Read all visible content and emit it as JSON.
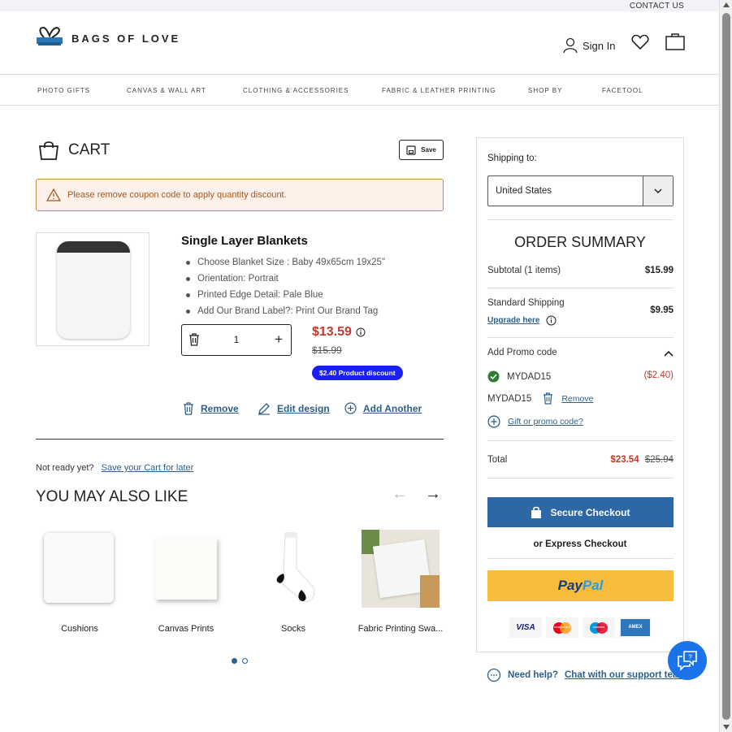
{
  "topbar": {
    "contact": "CONTACT US"
  },
  "header": {
    "logo_text": "BAGS OF LOVE",
    "signin": "Sign In"
  },
  "nav": [
    "PHOTO GIFTS",
    "CANVAS & WALL ART",
    "CLOTHING & ACCESSORIES",
    "FABRIC & LEATHER PRINTING",
    "SHOP BY",
    "FACETOOL"
  ],
  "cart": {
    "title": "CART",
    "save_label": "Save",
    "alert": "Please remove coupon code to apply quantity discount.",
    "item": {
      "name": "Single Layer Blankets",
      "options": [
        "Choose Blanket Size : Baby 49x65cm 19x25\"",
        "Orientation: Portrait",
        "Printed Edge Detail: Pale Blue",
        "Add Our Brand Label?: Print Our Brand Tag"
      ],
      "quantity": "1",
      "price": "$13.59",
      "old_price": "$15.99",
      "discount": "$2.40 Product discount"
    },
    "actions": {
      "remove": "Remove",
      "edit": "Edit design",
      "add": "Add Another"
    },
    "not_ready": "Not ready yet?",
    "save_later": "Save your Cart for later"
  },
  "recommendations": {
    "title": "YOU MAY ALSO LIKE",
    "items": [
      "Cushions",
      "Canvas Prints",
      "Socks",
      "Fabric Printing Swa..."
    ]
  },
  "summary": {
    "shipping_label": "Shipping to:",
    "country": "United States",
    "title": "ORDER SUMMARY",
    "subtotal_label": "Subtotal (1 items)",
    "subtotal": "$15.99",
    "shipping_name": "Standard Shipping",
    "upgrade": "Upgrade here",
    "shipping": "$9.95",
    "promo_label": "Add Promo code",
    "promo_code": "MYDAD15",
    "promo_amount": "($2.40)",
    "promo_code2": "MYDAD15",
    "promo_remove": "Remove",
    "gift_link": "Gift or promo code?",
    "total_label": "Total",
    "total": "$23.54",
    "total_old": "$25.94",
    "checkout": "Secure Checkout",
    "express": "or Express Checkout",
    "paypal_pay": "Pay",
    "paypal_pal": "Pal",
    "cards": [
      "VISA",
      "mastercard",
      "maestro",
      "AMEX"
    ]
  },
  "help": {
    "text": "Need help?",
    "link": "Chat with our support team"
  },
  "colors": {
    "accent": "#2d67a6",
    "price_red": "#c0392b",
    "discount_blue": "#1a1ff2",
    "paypal_yellow": "#f7bc3b"
  }
}
